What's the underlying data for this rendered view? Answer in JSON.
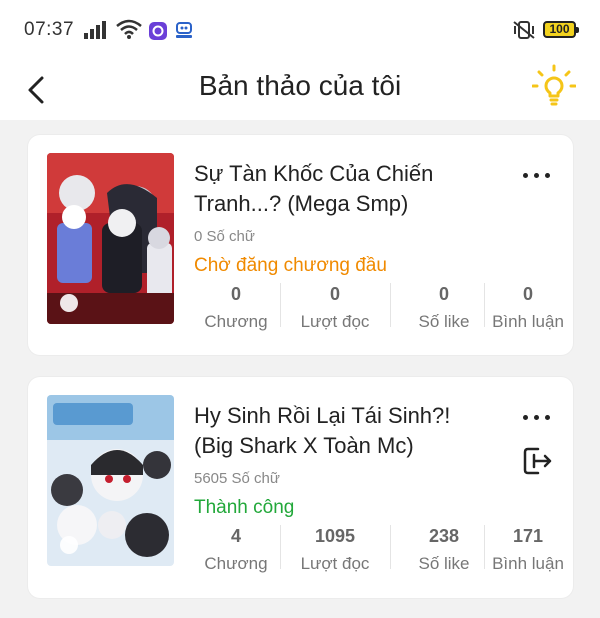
{
  "status_bar": {
    "time": "07:37",
    "battery": "100"
  },
  "header": {
    "title": "Bản thảo của tôi",
    "icons": {
      "back": "chevron-left-icon",
      "idea": "lightbulb-icon"
    }
  },
  "drafts": [
    {
      "title": "Sự Tàn Khốc Của Chiến Tranh...? (Mega Smp)",
      "word_count": "0 Số chữ",
      "status": "Chờ đăng chương đầu",
      "status_color": "#f08a00",
      "stats": [
        {
          "value": "0",
          "label": "Chương"
        },
        {
          "value": "0",
          "label": "Lượt đọc"
        },
        {
          "value": "0",
          "label": "Số like"
        },
        {
          "value": "0",
          "label": "Bình luận"
        }
      ]
    },
    {
      "title": "Hy Sinh Rồi Lại Tái Sinh?! (Big Shark X Toàn Mc)",
      "word_count": "5605 Số chữ",
      "status": "Thành công",
      "status_color": "#22a83a",
      "stats": [
        {
          "value": "4",
          "label": "Chương"
        },
        {
          "value": "1095",
          "label": "Lượt đọc"
        },
        {
          "value": "238",
          "label": "Số like"
        },
        {
          "value": "171",
          "label": "Bình luận"
        }
      ]
    }
  ],
  "colors": {
    "accent_bulb": "#f5c518",
    "background": "#f2f2f2"
  }
}
